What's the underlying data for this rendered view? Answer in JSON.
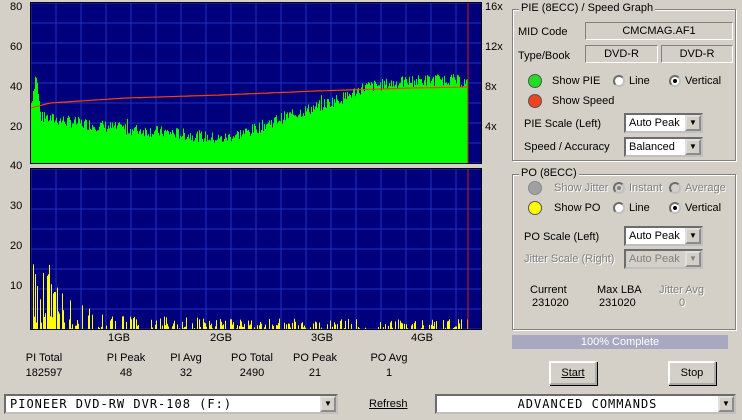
{
  "graph": {
    "top_left_ticks": [
      "80",
      "60",
      "40",
      "20"
    ],
    "top_right_ticks": [
      "16x",
      "12x",
      "8x",
      "4x"
    ],
    "bottom_left_ticks": [
      "40",
      "30",
      "20",
      "10"
    ],
    "x_ticks": [
      "1GB",
      "2GB",
      "3GB",
      "4GB"
    ]
  },
  "chart_data": [
    {
      "type": "area",
      "series": [
        {
          "name": "PIE",
          "color": "#00ff00"
        },
        {
          "name": "Speed",
          "color": "#ff4000"
        }
      ],
      "ylim": [
        0,
        80
      ],
      "y2lim": [
        0,
        16
      ],
      "x_range_gb": [
        0,
        4.7
      ],
      "pie_profile_x": [
        0,
        0.05,
        0.1,
        0.5,
        1.0,
        1.5,
        2.0,
        2.3,
        2.6,
        3.0,
        3.3,
        3.5,
        4.0,
        4.4,
        4.6
      ],
      "pie_profile_y": [
        30,
        45,
        23,
        20,
        17,
        15,
        12,
        16,
        22,
        28,
        33,
        38,
        41,
        42,
        40
      ],
      "speed_profile_x": [
        0,
        0.2,
        1.0,
        2.0,
        3.0,
        4.0,
        4.6
      ],
      "speed_profile_y": [
        5.5,
        6.0,
        6.5,
        6.8,
        7.2,
        7.5,
        7.6
      ]
    },
    {
      "type": "bar",
      "series": [
        {
          "name": "PO",
          "color": "#ffff00"
        }
      ],
      "ylim": [
        0,
        40
      ],
      "x_range_gb": [
        0,
        4.7
      ],
      "po_profile_x": [
        0,
        0.1,
        0.3,
        0.6,
        1.0,
        2.0,
        3.0,
        4.0,
        4.6
      ],
      "po_profile_y": [
        18,
        12,
        8,
        4,
        3,
        2,
        2,
        2,
        2
      ]
    }
  ],
  "stats": {
    "labels": [
      "PI Total",
      "PI Peak",
      "PI Avg",
      "PO Total",
      "PO Peak",
      "PO Avg"
    ],
    "values": [
      "182597",
      "48",
      "32",
      "2490",
      "21",
      "1"
    ]
  },
  "pie_panel": {
    "title": "PIE (8ECC) / Speed Graph",
    "mid_label": "MID Code",
    "mid_value": "CMCMAG.AF1",
    "type_label": "Type/Book",
    "type_value": "DVD-R",
    "book_value": "DVD-R",
    "show_pie": "Show PIE",
    "show_speed": "Show Speed",
    "line": "Line",
    "vertical": "Vertical",
    "scale_label": "PIE Scale (Left)",
    "scale_value": "Auto Peak",
    "speed_label": "Speed / Accuracy",
    "speed_value": "Balanced"
  },
  "po_panel": {
    "title": "PO (8ECC)",
    "show_jitter": "Show Jitter",
    "instant": "Instant",
    "average": "Average",
    "show_po": "Show PO",
    "line": "Line",
    "vertical": "Vertical",
    "scale_label": "PO Scale (Left)",
    "scale_value": "Auto Peak",
    "jitter_label": "Jitter Scale (Right)",
    "jitter_value": "Auto Peak",
    "current_label": "Current",
    "current_value": "231020",
    "maxlba_label": "Max LBA",
    "maxlba_value": "231020",
    "jitteravg_label": "Jitter Avg",
    "jitteravg_value": "0"
  },
  "progress": "100% Complete",
  "buttons": {
    "start": "Start",
    "stop": "Stop",
    "refresh": "Refresh"
  },
  "drive": "PIONEER DVD-RW  DVR-108  (F:)",
  "commands": "ADVANCED COMMANDS"
}
